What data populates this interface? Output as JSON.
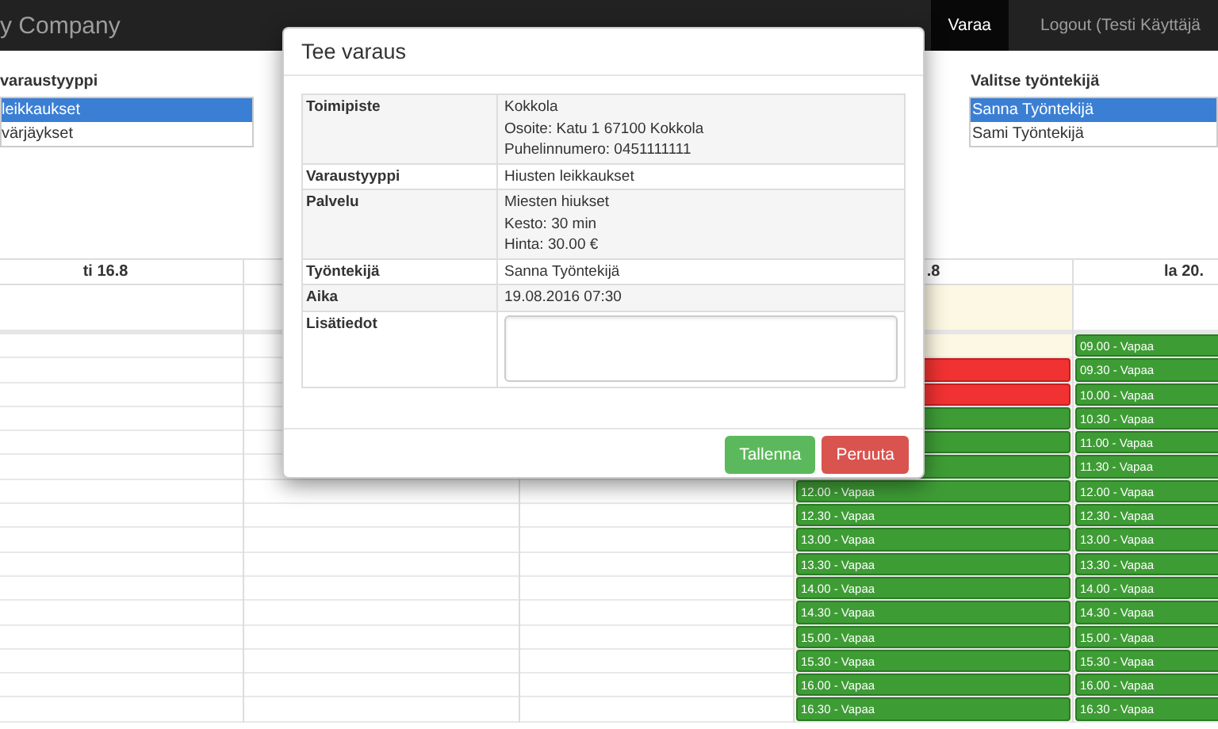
{
  "navbar": {
    "brand": "y Company",
    "items": [
      {
        "label": "Varaa",
        "selected": true
      },
      {
        "label": "Logout (Testi Käyttäjä",
        "selected": false
      }
    ]
  },
  "type_picker": {
    "title": "varaustyyppi",
    "options": [
      {
        "label": "leikkaukset",
        "selected": true
      },
      {
        "label": "värjäykset",
        "selected": false
      }
    ]
  },
  "employee_picker": {
    "title": "Valitse työntekijä",
    "options": [
      {
        "label": "Sanna Työntekijä",
        "selected": true
      },
      {
        "label": "Sami Työntekijä",
        "selected": false
      }
    ]
  },
  "calendar": {
    "columns": [
      {
        "label": "ti 16.8",
        "today": false
      },
      {
        "today": false
      },
      {
        "today": false
      },
      {
        "label": ".8",
        "today": true,
        "slots": [
          {
            "kind": "empty"
          },
          {
            "kind": "booked"
          },
          {
            "kind": "booked"
          },
          {
            "kind": "free"
          },
          {
            "kind": "free"
          },
          {
            "kind": "free"
          },
          {
            "kind": "free",
            "text": "12.00 - Vapaa"
          },
          {
            "kind": "free",
            "text": "12.30 - Vapaa"
          },
          {
            "kind": "free",
            "text": "13.00 - Vapaa"
          },
          {
            "kind": "free",
            "text": "13.30 - Vapaa"
          },
          {
            "kind": "free",
            "text": "14.00 - Vapaa"
          },
          {
            "kind": "free",
            "text": "14.30 - Vapaa"
          },
          {
            "kind": "free",
            "text": "15.00 - Vapaa"
          },
          {
            "kind": "free",
            "text": "15.30 - Vapaa"
          },
          {
            "kind": "free",
            "text": "16.00 - Vapaa"
          },
          {
            "kind": "free",
            "text": "16.30 - Vapaa"
          }
        ]
      },
      {
        "label": "la 20.",
        "today": false,
        "slots": [
          {
            "kind": "free",
            "text": "09.00 - Vapaa"
          },
          {
            "kind": "free",
            "text": "09.30 - Vapaa"
          },
          {
            "kind": "free",
            "text": "10.00 - Vapaa"
          },
          {
            "kind": "free",
            "text": "10.30 - Vapaa"
          },
          {
            "kind": "free",
            "text": "11.00 - Vapaa"
          },
          {
            "kind": "free",
            "text": "11.30 - Vapaa"
          },
          {
            "kind": "free",
            "text": "12.00 - Vapaa"
          },
          {
            "kind": "free",
            "text": "12.30 - Vapaa"
          },
          {
            "kind": "free",
            "text": "13.00 - Vapaa"
          },
          {
            "kind": "free",
            "text": "13.30 - Vapaa"
          },
          {
            "kind": "free",
            "text": "14.00 - Vapaa"
          },
          {
            "kind": "free",
            "text": "14.30 - Vapaa"
          },
          {
            "kind": "free",
            "text": "15.00 - Vapaa"
          },
          {
            "kind": "free",
            "text": "15.30 - Vapaa"
          },
          {
            "kind": "free",
            "text": "16.00 - Vapaa"
          },
          {
            "kind": "free",
            "text": "16.30 - Vapaa"
          }
        ]
      }
    ]
  },
  "dialog": {
    "title": "Tee varaus",
    "rows": [
      {
        "kind": "text",
        "label": "Toimipiste",
        "lines": [
          "Kokkola",
          "Osoite: Katu 1 67100 Kokkola",
          "Puhelinnumero: 0451111111"
        ]
      },
      {
        "kind": "text",
        "label": "Varaustyyppi",
        "lines": [
          "Hiusten leikkaukset"
        ]
      },
      {
        "kind": "text",
        "label": "Palvelu",
        "lines": [
          "Miesten hiukset",
          "Kesto: 30 min",
          "Hinta: 30.00 €"
        ]
      },
      {
        "kind": "text",
        "label": "Työntekijä",
        "lines": [
          "Sanna Työntekijä"
        ]
      },
      {
        "kind": "text",
        "label": "Aika",
        "lines": [
          "19.08.2016 07:30"
        ]
      },
      {
        "kind": "textarea",
        "label": "Lisätiedot"
      }
    ],
    "buttons": [
      {
        "label": "Tallenna",
        "kind": "primary"
      },
      {
        "label": "Peruuta",
        "kind": "danger"
      }
    ]
  }
}
